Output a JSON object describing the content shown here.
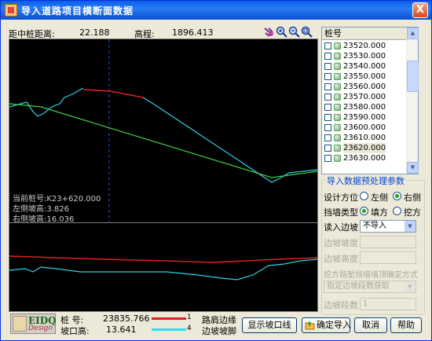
{
  "window": {
    "title": "导入道路项目横断面数据",
    "close_label": "X"
  },
  "info": {
    "dist_label": "距中桩距离:",
    "dist_value": "22.188",
    "elev_label": "高程:",
    "elev_value": "1896.413"
  },
  "plot_info": {
    "line1": "当前桩号:K23+620.000",
    "line2": "左侧坡高:3.826",
    "line3": "右侧坡高:16.036"
  },
  "list": {
    "header": "桩号",
    "items": [
      "23520.000",
      "23530.000",
      "23540.000",
      "23550.000",
      "23560.000",
      "23570.000",
      "23580.000",
      "23590.000",
      "23600.000",
      "23610.000",
      "23620.000",
      "23630.000"
    ],
    "selected_index": 10
  },
  "preprocess": {
    "group_title": "导入数据预处理参数",
    "design_dir_label": "设计方位",
    "left_label": "左侧",
    "right_label": "右侧",
    "wall_type_label": "挡墙类型",
    "fill_label": "填方",
    "cut_label": "挖方",
    "read_slope_label": "读入边坡",
    "read_slope_value": "不导入",
    "slope_ratio_label": "边坡坡度",
    "slope_height_label": "边坡高度",
    "method_label": "挖方路堑挡墙墙顶确定方式",
    "method_value": "指定边坡段数获取",
    "segments_label": "边坡段数",
    "segments_value": "1"
  },
  "bottom": {
    "logo_text": "EIDQ",
    "logo_sub": "Design",
    "station_label": "桩  号:",
    "station_value": "23835.766",
    "slope_top_label": "坡口高:",
    "slope_top_value": "13.641",
    "legend1_num": "1",
    "legend1_label": "路肩边缘",
    "legend2_num": "4",
    "legend2_label": "边坡坡脚",
    "btn_show": "显示坡口线",
    "btn_import": "确定导入",
    "btn_cancel": "取消",
    "btn_help": "帮助"
  },
  "colors": {
    "road_red": "#e02020",
    "terrain_cyan": "#30d0e8",
    "design_green": "#40d040",
    "cursor_blue": "#2040ff"
  }
}
